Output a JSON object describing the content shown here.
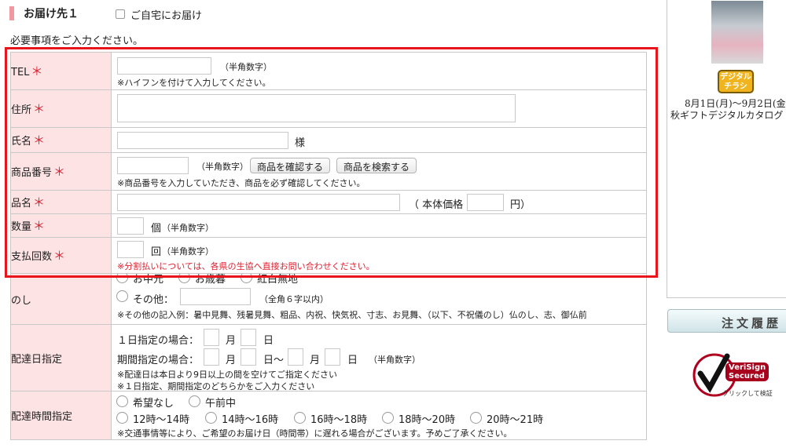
{
  "header": {
    "title": "お届け先１",
    "home_delivery_label": "ご自宅にお届け",
    "required_note": "必要事項をご入力ください。"
  },
  "rows": {
    "tel": {
      "label": "TEL",
      "hint": "（半角数字）",
      "note": "※ハイフンを付けて入力してください。"
    },
    "address": {
      "label": "住所"
    },
    "name": {
      "label": "氏名",
      "suffix": "様"
    },
    "product_no": {
      "label": "商品番号",
      "hint": "（半角数字）",
      "confirm_button": "商品を確認する",
      "search_button": "商品を検索する",
      "note": "※商品番号を入力していただき、商品を必ず確認してください。"
    },
    "product_name": {
      "label": "品名",
      "price_open": "（ 本体価格",
      "price_close": "円）"
    },
    "quantity": {
      "label": "数量",
      "unit": "個",
      "hint": "（半角数字）"
    },
    "installments": {
      "label": "支払回数",
      "unit": "回",
      "hint": "（半角数字）",
      "warning": "※分割払いについては、各県の生協へ直接お問い合わせください。"
    },
    "noshi": {
      "label": "のし",
      "opt1": "お中元",
      "opt2": "お歳暮",
      "opt3": "紅白無地",
      "other_label": "その他：",
      "other_hint": "（全角６字以内）",
      "note": "※その他の記入例：暑中見舞、残暑見舞、粗品、内祝、快気祝、寸志、お見舞、（以下、不祝儀のし）仏のし、志、御仏前"
    },
    "delivery_date": {
      "label": "配達日指定",
      "single_label": "１日指定の場合：",
      "month": "月",
      "day": "日",
      "range_label": "期間指定の場合：",
      "day_tilde": "日〜",
      "hint": "（半角数字）",
      "note1": "※配達日は本日より9日以上の間を空けてご指定ください",
      "note2": "※１日指定、期間指定のどちらかをご入力ください"
    },
    "delivery_time": {
      "label": "配達時間指定",
      "options": [
        "希望なし",
        "午前中",
        "12時〜14時",
        "14時〜16時",
        "16時〜18時",
        "18時〜20時",
        "20時〜21時"
      ],
      "note": "※交通事情等により、ご希望のお届け日（時間帯）に遅れる場合がございます。予めご了承ください。"
    }
  },
  "required_mark": "＊",
  "sidebar": {
    "badge_line1": "デジタル",
    "badge_line2": "チラシ",
    "date_text": "8月1日(月)〜9月2日(金",
    "catalog_text": "秋ギフトデジタルカタログ",
    "history_button": "注文履歴",
    "verisign_line1": "VeriSign",
    "verisign_line2": "Secured",
    "verisign_click": "クリックして検証"
  }
}
